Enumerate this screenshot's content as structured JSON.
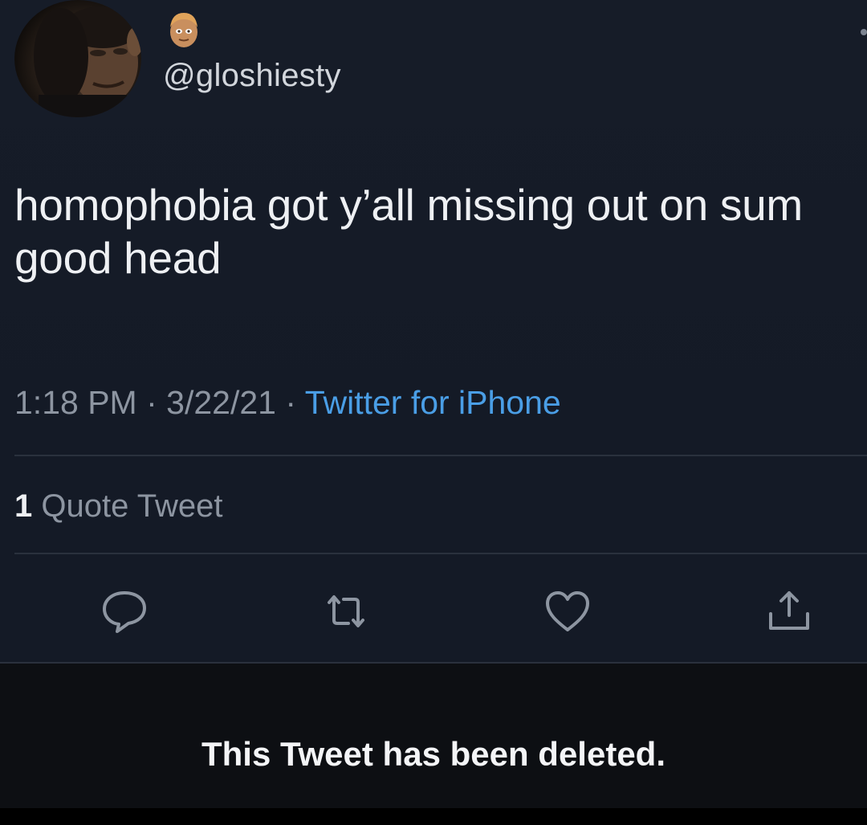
{
  "tweet": {
    "handle": "@gloshiesty",
    "text": "homophobia got y’all missing out on sum good head",
    "time": "1:18 PM",
    "date": "3/22/21",
    "separator": "·",
    "source": "Twitter for iPhone",
    "quote_count": "1",
    "quote_label": "Quote Tweet"
  },
  "notice": {
    "deleted_text": "This Tweet has been deleted."
  },
  "icons": {
    "avatar": "profile-photo",
    "badge": "man-emoji",
    "reply": "reply-icon",
    "retweet": "retweet-icon",
    "like": "heart-icon",
    "share": "share-icon"
  },
  "colors": {
    "background": "#151b27",
    "text_primary": "#eef0f3",
    "text_secondary": "#8d95a1",
    "link": "#4a9ee6",
    "deleted_bar": "#0d0f13"
  }
}
